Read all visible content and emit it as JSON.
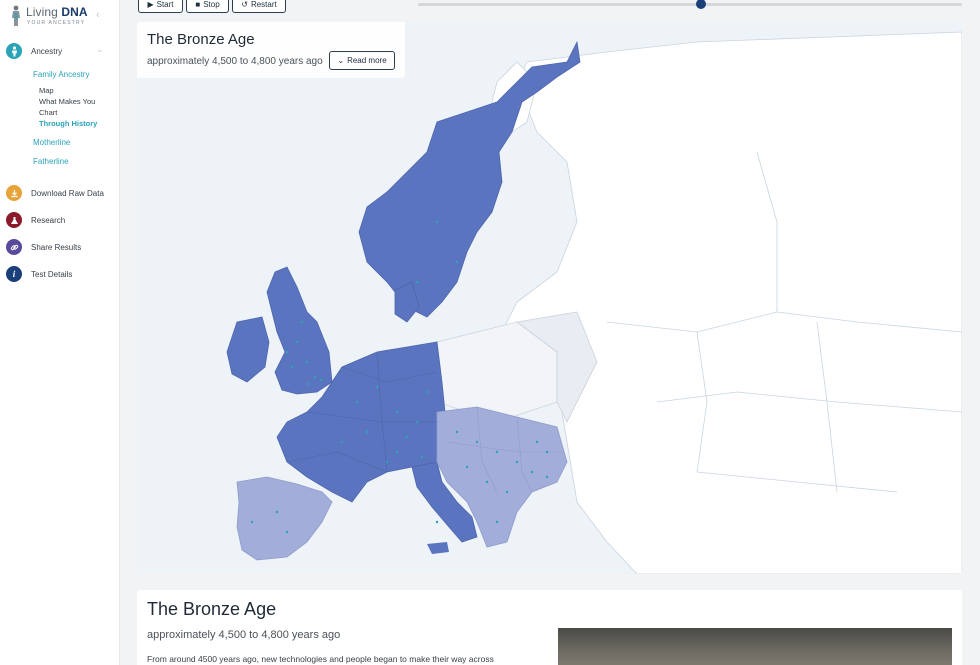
{
  "brand": {
    "name_light": "Living ",
    "name_bold": "DNA",
    "tagline": "YOUR ANCESTRY"
  },
  "sidebar": {
    "ancestry": {
      "label": "Ancestry",
      "icon": "person-icon",
      "color": "#2aa3b8"
    },
    "family_ancestry": "Family Ancestry",
    "family_items": [
      {
        "label": "Map",
        "active": false
      },
      {
        "label": "What Makes You",
        "active": false
      },
      {
        "label": "Chart",
        "active": false
      },
      {
        "label": "Through History",
        "active": true
      }
    ],
    "motherline": "Motherline",
    "fatherline": "Fatherline",
    "items": [
      {
        "label": "Download Raw Data",
        "icon": "download-icon",
        "color": "#e8a23a"
      },
      {
        "label": "Research",
        "icon": "flask-icon",
        "color": "#8b1a2b"
      },
      {
        "label": "Share Results",
        "icon": "link-icon",
        "color": "#5a4a9c"
      },
      {
        "label": "Test Details",
        "icon": "info-icon",
        "color": "#1b3f7a"
      }
    ]
  },
  "controls": {
    "start": "Start",
    "stop": "Stop",
    "restart": "Restart",
    "timeline_progress": 0.52
  },
  "map_panel": {
    "title": "The Bronze Age",
    "subtitle": "approximately 4,500 to 4,800 years ago",
    "read_more": "Read more"
  },
  "info_panel": {
    "title": "The Bronze Age",
    "subtitle": "approximately 4,500 to 4,800 years ago",
    "body": "From around 4500 years ago, new technologies and people began to make their way across"
  },
  "colors": {
    "primary_region": "#5b74bf",
    "secondary_region": "#a2aed9",
    "accent": "#2aa3b8"
  }
}
